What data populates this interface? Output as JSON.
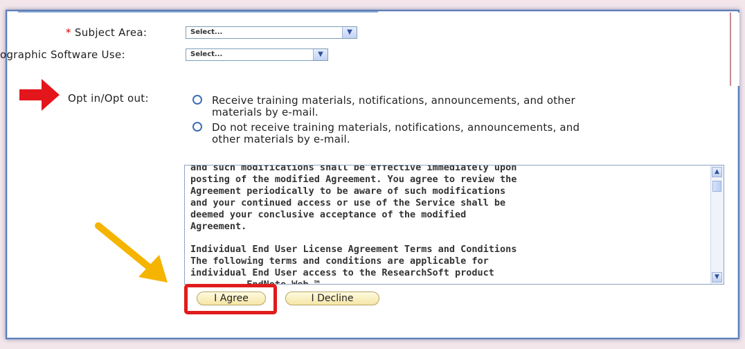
{
  "form": {
    "subject_area_label": "Subject Area:",
    "required_mark": "*",
    "subject_area_value": "Select...",
    "software_use_label": "ographic Software Use:",
    "software_use_value": "Select...",
    "opt_label": "Opt in/Opt out:",
    "opt_in_text": "Receive training materials, notifications, announcements, and other\nmaterials by e-mail.",
    "opt_out_text": "Do not receive training materials, notifications, announcements, and\nother materials by e-mail."
  },
  "license": {
    "lines": [
      "and such modifications shall be effective immediately upon",
      "posting of the modified Agreement. You agree to review the",
      "Agreement periodically to be aware of such modifications",
      "and your continued access or use of the Service shall be",
      "deemed your conclusive acceptance of the modified",
      "Agreement.",
      "",
      "Individual End User License Agreement Terms and Conditions",
      "The following terms and conditions are applicable for",
      "individual End User access to the ResearchSoft product",
      "          EndNote Web ™"
    ]
  },
  "buttons": {
    "agree": "I Agree",
    "decline": "I Decline"
  },
  "icons": {
    "dropdown": "chevron-down-icon",
    "scroll_up": "chevron-up-icon",
    "scroll_down": "chevron-down-icon"
  },
  "colors": {
    "required": "#d40000",
    "arrow_red": "#e3161b",
    "arrow_yellow": "#f5b400",
    "highlight": "#e01b1b"
  }
}
